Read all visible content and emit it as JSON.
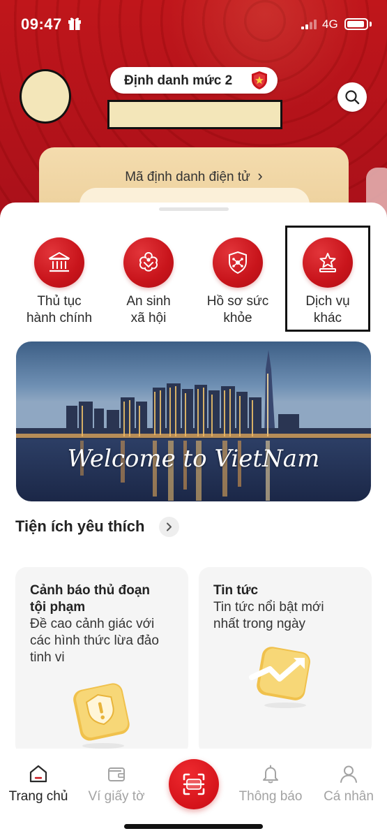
{
  "status_bar": {
    "time": "09:47",
    "network": "4G"
  },
  "header": {
    "level_label": "Định danh mức 2",
    "id_card_label": "Mã định danh điện tử",
    "id_card_chevron": "›"
  },
  "services": [
    {
      "label_line1": "Thủ tục",
      "label_line2": "hành chính",
      "icon": "government-building-icon"
    },
    {
      "label_line1": "An sinh",
      "label_line2": "xã hội",
      "icon": "social-welfare-icon"
    },
    {
      "label_line1": "Hồ sơ sức",
      "label_line2": "khỏe",
      "icon": "health-record-icon"
    },
    {
      "label_line1": "Dịch vụ",
      "label_line2": "khác",
      "icon": "star-podium-icon"
    }
  ],
  "banner": {
    "caption": "Welcome to VietNam"
  },
  "favorites": {
    "title": "Tiện ích yêu thích",
    "cards": [
      {
        "title_line1": "Cảnh báo thủ đoạn",
        "title_line2": "tội phạm",
        "desc_line1": "Đề cao cảnh giác với",
        "desc_line2": "các hình thức lừa đảo",
        "desc_line3": "tinh vi",
        "icon": "shield-warning-icon"
      },
      {
        "title_line1": "Tin tức",
        "desc_line1": "Tin tức nổi bật mới",
        "desc_line2": "nhất trong ngày",
        "icon": "trending-chart-icon"
      }
    ]
  },
  "bottom_nav": [
    {
      "label": "Trang chủ",
      "icon": "home-icon",
      "active": true
    },
    {
      "label": "Ví giấy tờ",
      "icon": "wallet-icon",
      "active": false
    },
    {
      "label": "Thông báo",
      "icon": "bell-icon",
      "active": false
    },
    {
      "label": "Cá nhân",
      "icon": "user-icon",
      "active": false
    }
  ],
  "colors": {
    "brand_red": "#c8141b",
    "avatar_fill": "#f3e6b9",
    "card_gold": "#f4dcae"
  }
}
